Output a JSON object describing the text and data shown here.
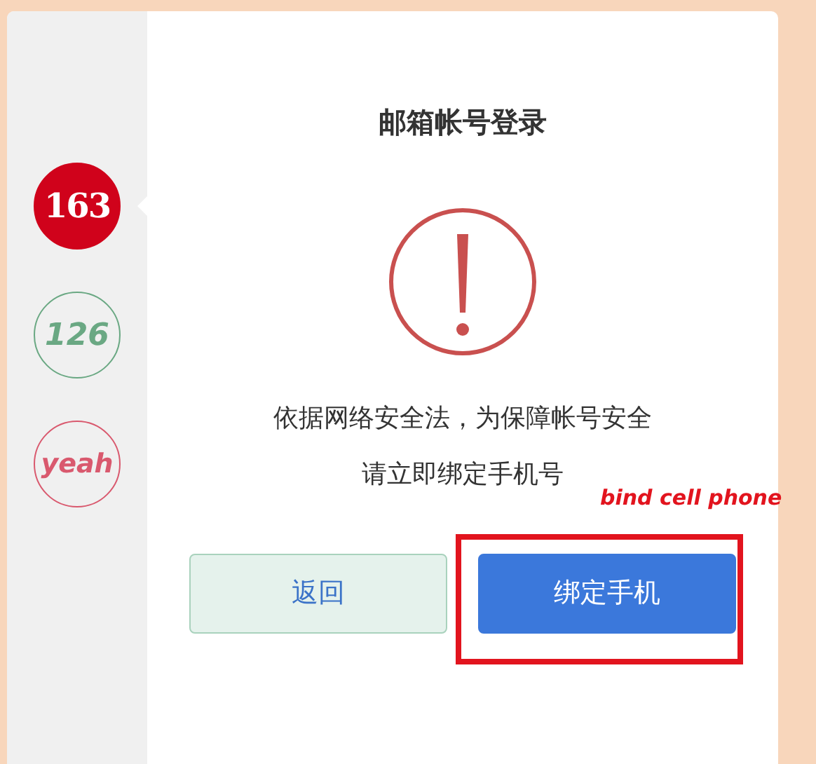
{
  "services": [
    {
      "label": "163",
      "color": "#d0021b",
      "selected": true
    },
    {
      "label": "126",
      "color": "#6aa883",
      "selected": false
    },
    {
      "label": "yeah",
      "color": "#d9596e",
      "selected": false
    }
  ],
  "title": "邮箱帐号登录",
  "message": [
    "依据网络安全法，为保障帐号安全",
    "请立即绑定手机号"
  ],
  "buttons": [
    {
      "label": "返回",
      "kind": "secondary"
    },
    {
      "label": "绑定手机",
      "kind": "primary"
    }
  ],
  "annotation": {
    "text": "bind cell phone"
  }
}
